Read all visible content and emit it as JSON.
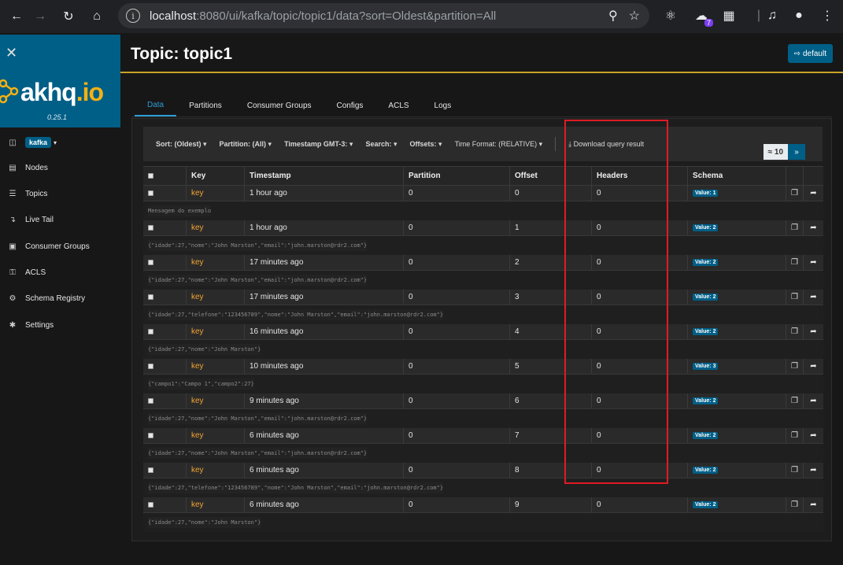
{
  "browser": {
    "url_host": "localhost",
    "url_rest": ":8080/ui/kafka/topic/topic1/data?sort=Oldest&partition=All",
    "extension_badge": "7"
  },
  "sidebar": {
    "logo_main": "akhq",
    "logo_suffix": ".io",
    "version": "0.25.1",
    "cluster": "kafka",
    "items": [
      {
        "label": "Nodes",
        "icon": "laptop-icon"
      },
      {
        "label": "Topics",
        "icon": "list-icon"
      },
      {
        "label": "Live Tail",
        "icon": "level-down-icon"
      },
      {
        "label": "Consumer Groups",
        "icon": "object-group-icon"
      },
      {
        "label": "ACLS",
        "icon": "key-icon"
      },
      {
        "label": "Schema Registry",
        "icon": "cogs-icon"
      },
      {
        "label": "Settings",
        "icon": "gear-icon"
      }
    ]
  },
  "header": {
    "title": "Topic: topic1",
    "default_button": "default"
  },
  "tabs": [
    "Data",
    "Partitions",
    "Consumer Groups",
    "Configs",
    "ACLS",
    "Logs"
  ],
  "toolbar": {
    "sort": "Sort: (Oldest)",
    "partition": "Partition: (All)",
    "timestamp": "Timestamp GMT-3:",
    "search": "Search:",
    "offsets": "Offsets:",
    "time_format": "Time Format: (RELATIVE)",
    "download": "Download query result",
    "page_count": "≈ 10",
    "next": "»"
  },
  "table": {
    "headers": [
      "Key",
      "Timestamp",
      "Partition",
      "Offset",
      "Headers",
      "Schema"
    ],
    "rows": [
      {
        "key": "key",
        "timestamp": "1 hour ago",
        "partition": "0",
        "offset": "0",
        "headers": "0",
        "schema": "Value: 1",
        "value": "Mensagem do exemplo"
      },
      {
        "key": "key",
        "timestamp": "1 hour ago",
        "partition": "0",
        "offset": "1",
        "headers": "0",
        "schema": "Value: 2",
        "value": "{\"idade\":27,\"nome\":\"John Marston\",\"email\":\"john.marston@rdr2.com\"}"
      },
      {
        "key": "key",
        "timestamp": "17 minutes ago",
        "partition": "0",
        "offset": "2",
        "headers": "0",
        "schema": "Value: 2",
        "value": "{\"idade\":27,\"nome\":\"John Marston\",\"email\":\"john.marston@rdr2.com\"}"
      },
      {
        "key": "key",
        "timestamp": "17 minutes ago",
        "partition": "0",
        "offset": "3",
        "headers": "0",
        "schema": "Value: 2",
        "value": "{\"idade\":27,\"telefone\":\"123456789\",\"nome\":\"John Marston\",\"email\":\"john.marston@rdr2.com\"}"
      },
      {
        "key": "key",
        "timestamp": "16 minutes ago",
        "partition": "0",
        "offset": "4",
        "headers": "0",
        "schema": "Value: 2",
        "value": "{\"idade\":27,\"nome\":\"John Marston\"}"
      },
      {
        "key": "key",
        "timestamp": "10 minutes ago",
        "partition": "0",
        "offset": "5",
        "headers": "0",
        "schema": "Value: 3",
        "value": "{\"campo1\":\"Campo 1\",\"campo2\":27}"
      },
      {
        "key": "key",
        "timestamp": "9 minutes ago",
        "partition": "0",
        "offset": "6",
        "headers": "0",
        "schema": "Value: 2",
        "value": "{\"idade\":27,\"nome\":\"John Marston\",\"email\":\"john.marston@rdr2.com\"}"
      },
      {
        "key": "key",
        "timestamp": "6 minutes ago",
        "partition": "0",
        "offset": "7",
        "headers": "0",
        "schema": "Value: 2",
        "value": "{\"idade\":27,\"nome\":\"John Marston\",\"email\":\"john.marston@rdr2.com\"}"
      },
      {
        "key": "key",
        "timestamp": "6 minutes ago",
        "partition": "0",
        "offset": "8",
        "headers": "0",
        "schema": "Value: 2",
        "value": "{\"idade\":27,\"telefone\":\"123456789\",\"nome\":\"John Marston\",\"email\":\"john.marston@rdr2.com\"}"
      },
      {
        "key": "key",
        "timestamp": "6 minutes ago",
        "partition": "0",
        "offset": "9",
        "headers": "0",
        "schema": "Value: 2",
        "value": "{\"idade\":27,\"nome\":\"John Marston\"}"
      }
    ]
  },
  "colors": {
    "brand": "#005f87",
    "accent_gold": "#c9a227",
    "key_orange": "#f3a533",
    "highlight_red": "#e01b24"
  }
}
